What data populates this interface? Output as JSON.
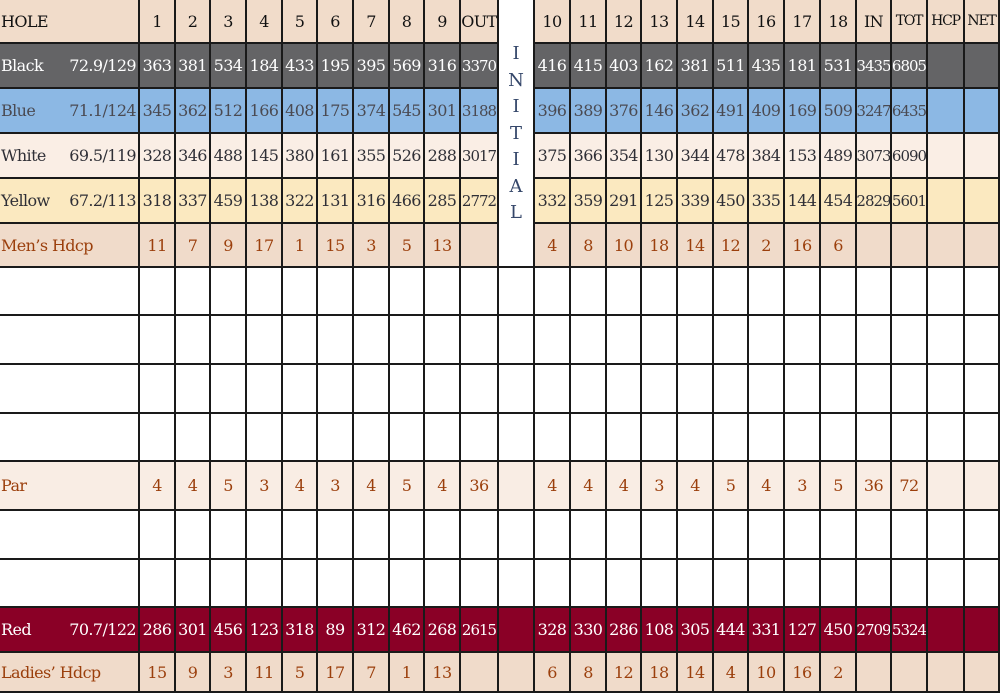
{
  "scorecard": {
    "header": {
      "label": "HOLE",
      "front": [
        "1",
        "2",
        "3",
        "4",
        "5",
        "6",
        "7",
        "8",
        "9"
      ],
      "out": "OUT",
      "back": [
        "10",
        "11",
        "12",
        "13",
        "14",
        "15",
        "16",
        "17",
        "18"
      ],
      "in": "IN",
      "tot": "TOT",
      "hcp": "HCP",
      "net": "NET"
    },
    "initial_label": [
      "I",
      "N",
      "I",
      "T",
      "I",
      "A",
      "L"
    ],
    "tees": [
      {
        "key": "black",
        "name": "Black",
        "rating": "72.9/129",
        "front": [
          "363",
          "381",
          "534",
          "184",
          "433",
          "195",
          "395",
          "569",
          "316"
        ],
        "out": "3370",
        "back": [
          "416",
          "415",
          "403",
          "162",
          "381",
          "511",
          "435",
          "181",
          "531"
        ],
        "in": "3435",
        "tot": "6805",
        "color": "#646466"
      },
      {
        "key": "blue",
        "name": "Blue",
        "rating": "71.1/124",
        "front": [
          "345",
          "362",
          "512",
          "166",
          "408",
          "175",
          "374",
          "545",
          "301"
        ],
        "out": "3188",
        "back": [
          "396",
          "389",
          "376",
          "146",
          "362",
          "491",
          "409",
          "169",
          "509"
        ],
        "in": "3247",
        "tot": "6435",
        "color": "#8cb8e4"
      },
      {
        "key": "white",
        "name": "White",
        "rating": "69.5/119",
        "front": [
          "328",
          "346",
          "488",
          "145",
          "380",
          "161",
          "355",
          "526",
          "288"
        ],
        "out": "3017",
        "back": [
          "375",
          "366",
          "354",
          "130",
          "344",
          "478",
          "384",
          "153",
          "489"
        ],
        "in": "3073",
        "tot": "6090",
        "color": "#faeee5"
      },
      {
        "key": "yellow",
        "name": "Yellow",
        "rating": "67.2/113",
        "front": [
          "318",
          "337",
          "459",
          "138",
          "322",
          "131",
          "316",
          "466",
          "285"
        ],
        "out": "2772",
        "back": [
          "332",
          "359",
          "291",
          "125",
          "339",
          "450",
          "335",
          "144",
          "454"
        ],
        "in": "2829",
        "tot": "5601",
        "color": "#fbe9c0"
      }
    ],
    "mens_hdcp": {
      "label": "Men’s Hdcp",
      "front": [
        "11",
        "7",
        "9",
        "17",
        "1",
        "15",
        "3",
        "5",
        "13"
      ],
      "back": [
        "4",
        "8",
        "10",
        "18",
        "14",
        "12",
        "2",
        "16",
        "6"
      ]
    },
    "par": {
      "label": "Par",
      "front": [
        "4",
        "4",
        "5",
        "3",
        "4",
        "3",
        "4",
        "5",
        "4"
      ],
      "out": "36",
      "back": [
        "4",
        "4",
        "4",
        "3",
        "4",
        "5",
        "4",
        "3",
        "5"
      ],
      "in": "36",
      "tot": "72"
    },
    "red": {
      "name": "Red",
      "rating": "70.7/122",
      "front": [
        "286",
        "301",
        "456",
        "123",
        "318",
        "89",
        "312",
        "462",
        "268"
      ],
      "out": "2615",
      "back": [
        "328",
        "330",
        "286",
        "108",
        "305",
        "444",
        "331",
        "127",
        "450"
      ],
      "in": "2709",
      "tot": "5324",
      "color": "#8a0026"
    },
    "ladies_hdcp": {
      "label": "Ladies’ Hdcp",
      "front": [
        "15",
        "9",
        "3",
        "11",
        "5",
        "17",
        "7",
        "1",
        "13"
      ],
      "back": [
        "6",
        "8",
        "12",
        "18",
        "14",
        "4",
        "10",
        "16",
        "2"
      ]
    }
  }
}
